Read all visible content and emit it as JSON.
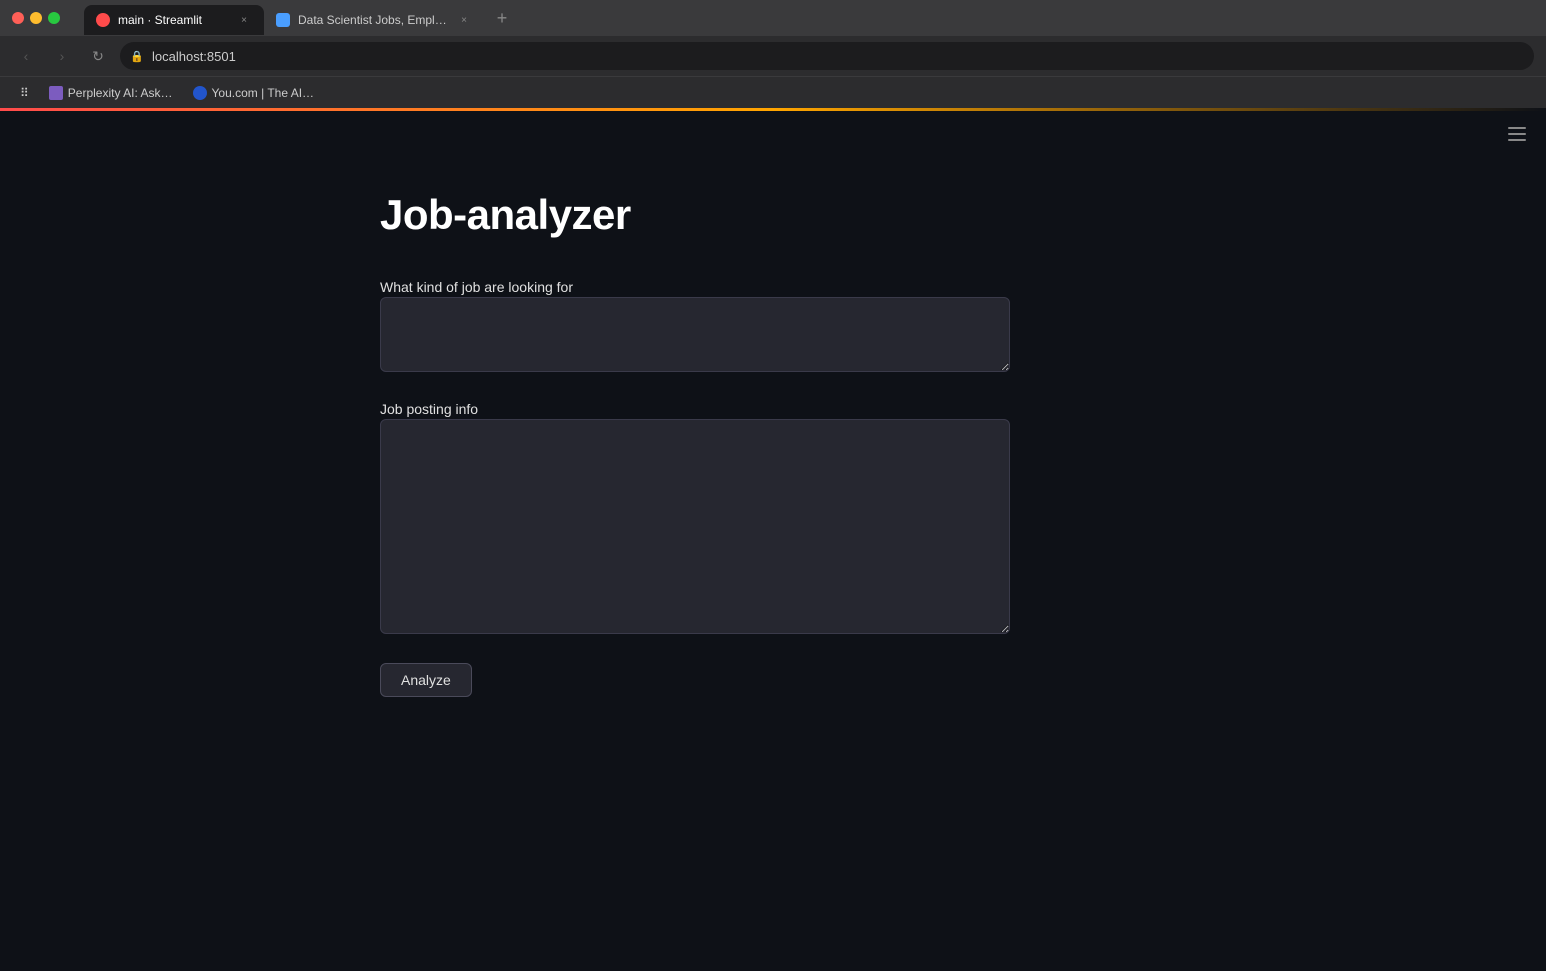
{
  "browser": {
    "tabs": [
      {
        "id": "tab-streamlit",
        "title": "main · Streamlit",
        "url": "localhost:8501",
        "favicon_type": "streamlit",
        "active": true,
        "close_label": "×"
      },
      {
        "id": "tab-jobs",
        "title": "Data Scientist Jobs, Employme…",
        "url": "https://www.datasciencejobs.com",
        "favicon_type": "job",
        "active": false,
        "close_label": "×"
      }
    ],
    "new_tab_label": "+",
    "address": "localhost:8501",
    "back_label": "‹",
    "forward_label": "›",
    "refresh_label": "↻",
    "bookmarks": [
      {
        "label": "Perplexity AI: Ask…",
        "favicon": "#7c5cbf"
      },
      {
        "label": "You.com | The AI…",
        "favicon": "#2255cc"
      }
    ],
    "apps_label": "⠿"
  },
  "app": {
    "title": "Job-analyzer",
    "field1_label": "What kind of job are looking for",
    "field1_value": "",
    "field1_placeholder": "",
    "field2_label": "Job posting info",
    "field2_value": "",
    "field2_placeholder": "",
    "analyze_button_label": "Analyze"
  },
  "icons": {
    "hamburger": "≡",
    "lock": "🔒"
  }
}
